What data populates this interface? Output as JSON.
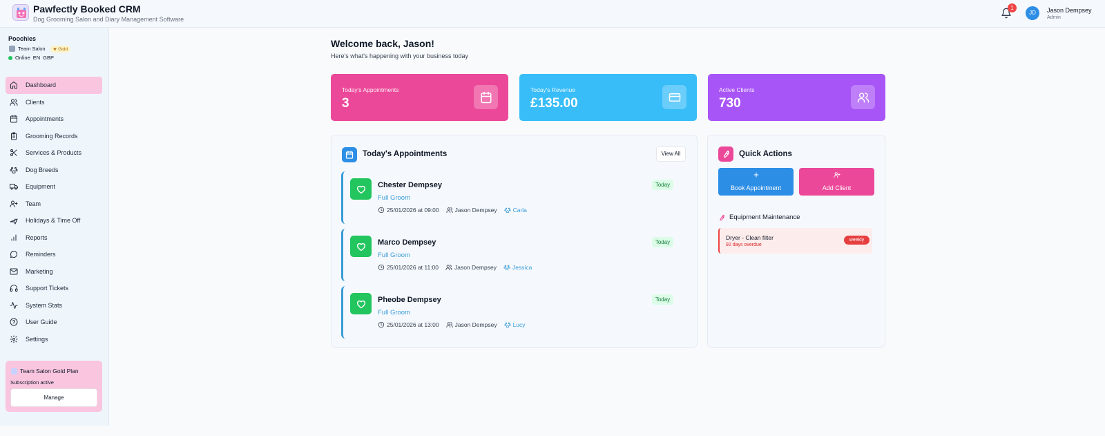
{
  "header": {
    "title": "Pawfectly Booked CRM",
    "subtitle": "Dog Grooming Salon and Diary Management Software",
    "notification_count": "1",
    "user_initials": "JD",
    "user_name": "Jason Dempsey",
    "user_role": "Admin"
  },
  "sidebar": {
    "org_name": "Poochies",
    "team_label": "Team Salon",
    "tier_badge": "Gold",
    "status": "Online",
    "language": "EN",
    "currency": "GBP",
    "items": [
      {
        "label": "Dashboard",
        "icon": "home-icon"
      },
      {
        "label": "Clients",
        "icon": "users-icon"
      },
      {
        "label": "Appointments",
        "icon": "calendar-icon"
      },
      {
        "label": "Grooming Records",
        "icon": "clipboard-icon"
      },
      {
        "label": "Services & Products",
        "icon": "scissors-icon"
      },
      {
        "label": "Dog Breeds",
        "icon": "paw-icon"
      },
      {
        "label": "Equipment",
        "icon": "truck-icon"
      },
      {
        "label": "Team",
        "icon": "user-plus-icon"
      },
      {
        "label": "Holidays & Time Off",
        "icon": "plane-icon"
      },
      {
        "label": "Reports",
        "icon": "bar-chart-icon"
      },
      {
        "label": "Reminders",
        "icon": "message-icon"
      },
      {
        "label": "Marketing",
        "icon": "mail-icon"
      },
      {
        "label": "Support Tickets",
        "icon": "headphones-icon"
      },
      {
        "label": "System Stats",
        "icon": "activity-icon"
      },
      {
        "label": "User Guide",
        "icon": "help-icon"
      },
      {
        "label": "Settings",
        "icon": "gear-icon"
      }
    ],
    "active_item": "Dashboard",
    "plan": {
      "title": "Team Salon Gold Plan",
      "status": "Subscription active",
      "button": "Manage"
    }
  },
  "main": {
    "welcome": "Welcome back, Jason!",
    "welcome_sub": "Here's what's happening with your business today",
    "stats": [
      {
        "label": "Today's Appointments",
        "value": "3",
        "color": "#ec4899",
        "icon": "calendar-icon"
      },
      {
        "label": "Today's Revenue",
        "value": "£135.00",
        "color": "#38bdf8",
        "icon": "credit-card-icon"
      },
      {
        "label": "Active Clients",
        "value": "730",
        "color": "#a855f7",
        "icon": "users-icon"
      }
    ],
    "appointments_panel": {
      "title": "Today's Appointments",
      "view_all": "View All",
      "items": [
        {
          "pet": "Chester Dempsey",
          "service": "Full Groom",
          "datetime": "25/01/2026 at 09:00",
          "owner": "Jason Dempsey",
          "groomer": "Carla",
          "badge": "Today"
        },
        {
          "pet": "Marco Dempsey",
          "service": "Full Groom",
          "datetime": "25/01/2026 at 11:00",
          "owner": "Jason Dempsey",
          "groomer": "Jessica",
          "badge": "Today"
        },
        {
          "pet": "Pheobe Dempsey",
          "service": "Full Groom",
          "datetime": "25/01/2026 at 13:00",
          "owner": "Jason Dempsey",
          "groomer": "Lucy",
          "badge": "Today"
        }
      ]
    },
    "quick_actions": {
      "title": "Quick Actions",
      "book_appointment": "Book Appointment",
      "add_client": "Add Client",
      "maintenance_title": "Equipment Maintenance",
      "maintenance": {
        "name": "Dryer - Clean filter",
        "due": "92 days overdue",
        "frequency": "weekly"
      }
    }
  },
  "colors": {
    "pink": "#ec4899",
    "blue": "#38bdf8",
    "purple": "#a855f7",
    "accent_blue": "#2d8ee6",
    "success": "#22c55e",
    "danger": "#ef4444"
  }
}
